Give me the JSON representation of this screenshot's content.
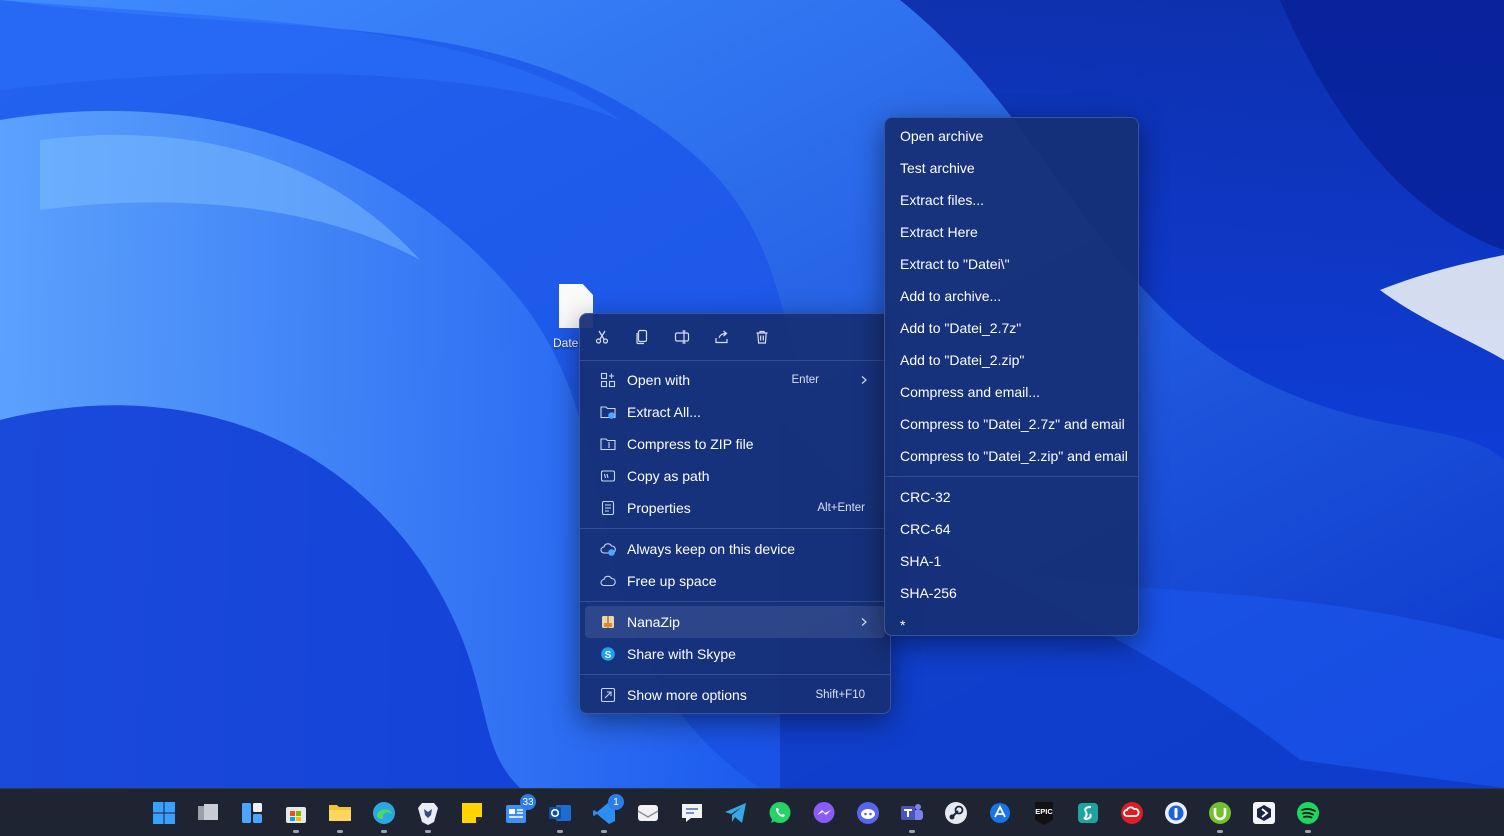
{
  "desktop": {
    "file_label": "Datei_2.7z",
    "colors": {
      "wallpaper_base": "#1d4fd6",
      "menu_bg": "#163076",
      "taskbar_bg": "#1f2433"
    }
  },
  "context_menu": {
    "action_bar": [
      {
        "name": "cut",
        "icon": "scissors-icon"
      },
      {
        "name": "copy",
        "icon": "copy-icon"
      },
      {
        "name": "rename",
        "icon": "rename-icon"
      },
      {
        "name": "share",
        "icon": "share-icon"
      },
      {
        "name": "delete",
        "icon": "trash-icon"
      }
    ],
    "items": {
      "open_with": {
        "label": "Open with",
        "shortcut": "Enter"
      },
      "extract_all": {
        "label": "Extract All..."
      },
      "compress_zip": {
        "label": "Compress to ZIP file"
      },
      "copy_path": {
        "label": "Copy as path"
      },
      "properties": {
        "label": "Properties",
        "shortcut": "Alt+Enter"
      },
      "always_keep": {
        "label": "Always keep on this device"
      },
      "free_space": {
        "label": "Free up space"
      },
      "nanazip": {
        "label": "NanaZip"
      },
      "share_skype": {
        "label": "Share with Skype"
      },
      "more_options": {
        "label": "Show more options",
        "shortcut": "Shift+F10"
      }
    }
  },
  "nanazip_submenu": {
    "group1": [
      "Open archive",
      "Test archive",
      "Extract files...",
      "Extract Here",
      "Extract to \"Datei\\\"",
      "Add to archive...",
      "Add to \"Datei_2.7z\"",
      "Add to \"Datei_2.zip\"",
      "Compress and email...",
      "Compress to \"Datei_2.7z\" and email",
      "Compress to \"Datei_2.zip\" and email"
    ],
    "group2": [
      "CRC-32",
      "CRC-64",
      "SHA-1",
      "SHA-256",
      "*"
    ]
  },
  "taskbar": {
    "apps": [
      {
        "name": "start",
        "icon": "windows-logo-icon"
      },
      {
        "name": "task-view",
        "icon": "task-view-icon"
      },
      {
        "name": "widgets",
        "icon": "widgets-icon"
      },
      {
        "name": "store",
        "icon": "store-icon"
      },
      {
        "name": "file-explorer",
        "icon": "folder-icon"
      },
      {
        "name": "edge",
        "icon": "edge-icon"
      },
      {
        "name": "brave",
        "icon": "brave-icon"
      },
      {
        "name": "sticky-notes",
        "icon": "sticky-notes-icon"
      },
      {
        "name": "news",
        "icon": "news-icon",
        "badge": "33"
      },
      {
        "name": "outlook",
        "icon": "outlook-icon"
      },
      {
        "name": "visual-studio",
        "icon": "visual-studio-icon",
        "badge": "1"
      },
      {
        "name": "mail",
        "icon": "mail-icon"
      },
      {
        "name": "feedback",
        "icon": "feedback-icon"
      },
      {
        "name": "telegram",
        "icon": "telegram-icon"
      },
      {
        "name": "whatsapp",
        "icon": "whatsapp-icon"
      },
      {
        "name": "messenger",
        "icon": "messenger-icon"
      },
      {
        "name": "discord",
        "icon": "discord-icon"
      },
      {
        "name": "teams",
        "icon": "teams-icon"
      },
      {
        "name": "steam",
        "icon": "steam-icon"
      },
      {
        "name": "app-dev",
        "icon": "app-icon"
      },
      {
        "name": "epic-games",
        "icon": "epic-games-icon",
        "text": "EPIC"
      },
      {
        "name": "surfshark",
        "icon": "surfshark-icon"
      },
      {
        "name": "creative-cloud",
        "icon": "creative-cloud-icon"
      },
      {
        "name": "1password",
        "icon": "1password-icon"
      },
      {
        "name": "utorrent",
        "icon": "utorrent-icon"
      },
      {
        "name": "dev-tool",
        "icon": "hexagon-icon"
      },
      {
        "name": "spotify",
        "icon": "spotify-icon"
      }
    ]
  }
}
